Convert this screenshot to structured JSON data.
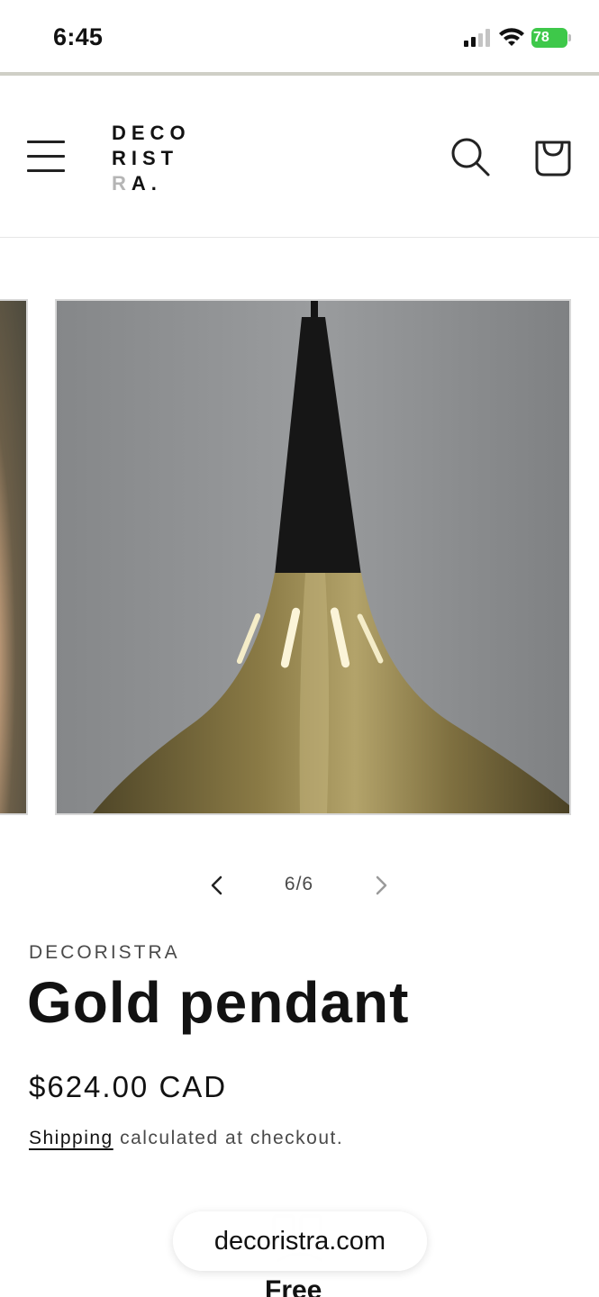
{
  "status_bar": {
    "time": "6:45",
    "battery_level": "78",
    "battery_color": "#3ec84a",
    "icons": [
      "signal-icon",
      "wifi-icon",
      "battery-charging-icon"
    ]
  },
  "header": {
    "logo": {
      "line1": "DECO",
      "line2": "RIST",
      "line3_light": "R",
      "line3_dark": "A."
    },
    "icons": [
      "hamburger-menu-icon",
      "search-icon",
      "shopping-bag-icon"
    ]
  },
  "gallery": {
    "counter": "6/6",
    "icons": [
      "chevron-left-icon",
      "chevron-right-icon"
    ]
  },
  "product": {
    "vendor": "DECORISTRA",
    "title": "Gold pendant",
    "price": "$624.00 CAD",
    "shipping_link": "Shipping",
    "shipping_rest": " calculated at checkout."
  },
  "bottom": {
    "partial_text": "Free",
    "url": "decoristra.com"
  },
  "colors": {
    "text": "#121212",
    "muted": "#4a4a4a",
    "brass": "#8a7a45",
    "wall": "#8c8e90"
  }
}
